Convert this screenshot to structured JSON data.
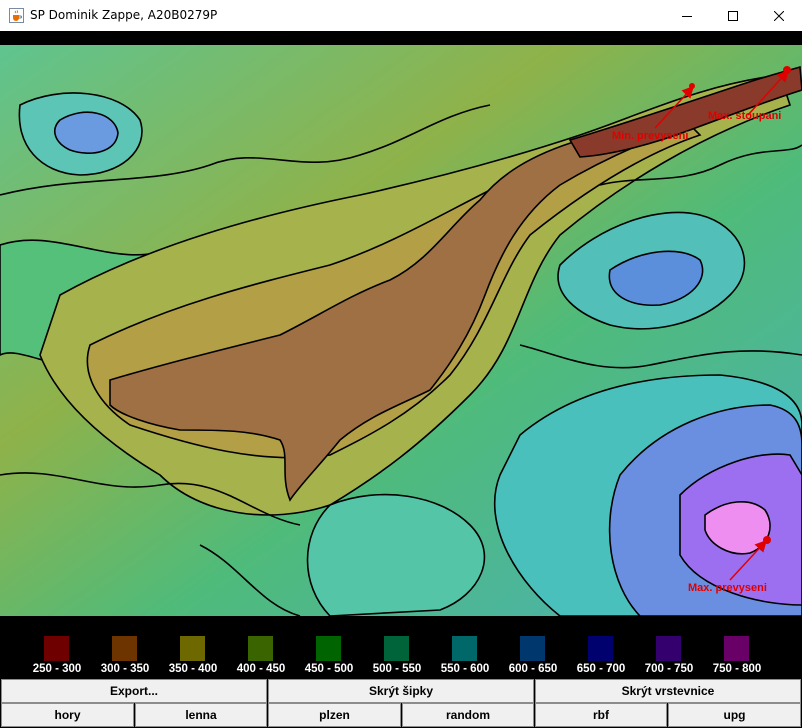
{
  "window": {
    "title": "SP Dominik Zappe, A20B0279P",
    "icon": "java-cup-icon",
    "controls": [
      "minimize-icon",
      "maximize-icon",
      "close-icon"
    ]
  },
  "map": {
    "labels": {
      "max_slope": "Max. stoupani",
      "min_elevation": "Min. prevyseni",
      "max_elevation": "Max. prevyseni"
    },
    "arrow_color": "#e00000",
    "contour_color": "#000000"
  },
  "legend": [
    {
      "label": "250 - 300",
      "color": "#6e0000"
    },
    {
      "label": "300 - 350",
      "color": "#6e3400"
    },
    {
      "label": "350 - 400",
      "color": "#6e6800"
    },
    {
      "label": "400 - 450",
      "color": "#3a6400"
    },
    {
      "label": "450 - 500",
      "color": "#006400"
    },
    {
      "label": "500 - 550",
      "color": "#00643a"
    },
    {
      "label": "550 - 600",
      "color": "#006868"
    },
    {
      "label": "600 - 650",
      "color": "#00386e"
    },
    {
      "label": "650 - 700",
      "color": "#00006e"
    },
    {
      "label": "700 - 750",
      "color": "#34006e"
    },
    {
      "label": "750 - 800",
      "color": "#680068"
    }
  ],
  "buttons": {
    "export": "Export...",
    "toggle_arrows": "Skrýt šipky",
    "toggle_contours": "Skrýt vrstevnice",
    "datasets": [
      "hory",
      "lenna",
      "plzen",
      "random",
      "rbf",
      "upg"
    ]
  }
}
